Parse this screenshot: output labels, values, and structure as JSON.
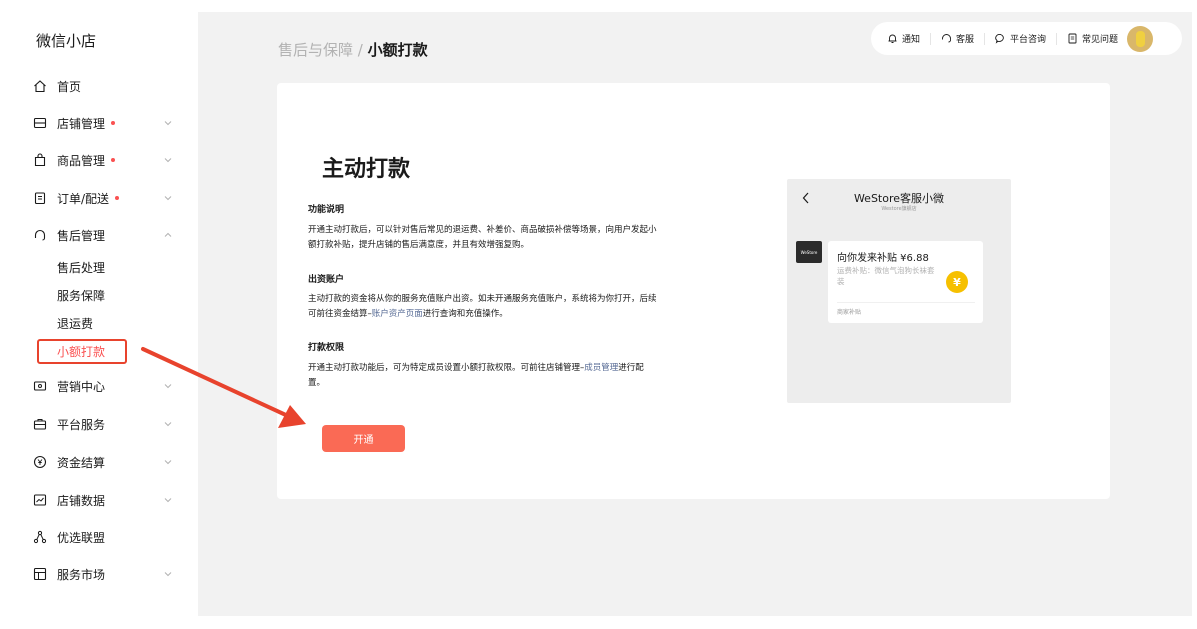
{
  "sidebar": {
    "brand": "微信小店",
    "items": [
      {
        "label": "首页",
        "icon": "home-icon",
        "dot": false,
        "chevron": false
      },
      {
        "label": "店铺管理",
        "icon": "store-icon",
        "dot": true,
        "chevron": true
      },
      {
        "label": "商品管理",
        "icon": "bag-icon",
        "dot": true,
        "chevron": true
      },
      {
        "label": "订单/配送",
        "icon": "clipboard-icon",
        "dot": true,
        "chevron": true
      },
      {
        "label": "售后管理",
        "icon": "headset-icon",
        "dot": false,
        "chevron": true
      },
      {
        "label": "营销中心",
        "icon": "coupon-icon",
        "dot": false,
        "chevron": true
      },
      {
        "label": "平台服务",
        "icon": "toolbox-icon",
        "dot": false,
        "chevron": true
      },
      {
        "label": "资金结算",
        "icon": "yuan-coin-icon",
        "dot": false,
        "chevron": true
      },
      {
        "label": "店铺数据",
        "icon": "chart-icon",
        "dot": false,
        "chevron": true
      },
      {
        "label": "优选联盟",
        "icon": "network-icon",
        "dot": false,
        "chevron": false
      },
      {
        "label": "服务市场",
        "icon": "market-icon",
        "dot": false,
        "chevron": true
      }
    ],
    "after_sales_sub": [
      "售后处理",
      "服务保障",
      "退运费",
      "小额打款"
    ]
  },
  "breadcrumb": {
    "parent": "售后与保障 / ",
    "current": "小额打款"
  },
  "topbar": {
    "notify": "通知",
    "service": "客服",
    "consult": "平台咨询",
    "faq": "常见问题"
  },
  "content": {
    "title": "主动打款",
    "sections": [
      {
        "title": "功能说明",
        "text": "开通主动打款后，可以针对售后常见的退运费、补差价、商品破损补偿等场景，向用户发起小额打款补贴，提升店铺的售后满意度，并且有效增强复购。"
      },
      {
        "title": "出资账户",
        "text_before": "主动打款的资金将从你的服务充值账户出资。如未开通服务充值账户，系统将为你打开，后续可前往资金结算–",
        "link": "账户资产页面",
        "text_after": "进行查询和充值操作。"
      },
      {
        "title": "打款权限",
        "text_before": "开通主动打款功能后，可为特定成员设置小额打款权限。可前往店铺管理–",
        "link": "成员管理",
        "text_after": "进行配置。"
      }
    ],
    "open_button": "开通"
  },
  "preview": {
    "title": "WeStore客服小微",
    "subtitle": "Westore旗舰店",
    "logo_text": "WeStore",
    "amount": "向你发来补贴 ¥6.88",
    "desc": "运费补贴：微信气泡狗长袜套装",
    "coin": "¥",
    "footer": "商家补贴"
  },
  "colors": {
    "accent": "#fa5151",
    "button": "#fa6a55",
    "link": "#576b95",
    "annotation": "#e8432d"
  }
}
